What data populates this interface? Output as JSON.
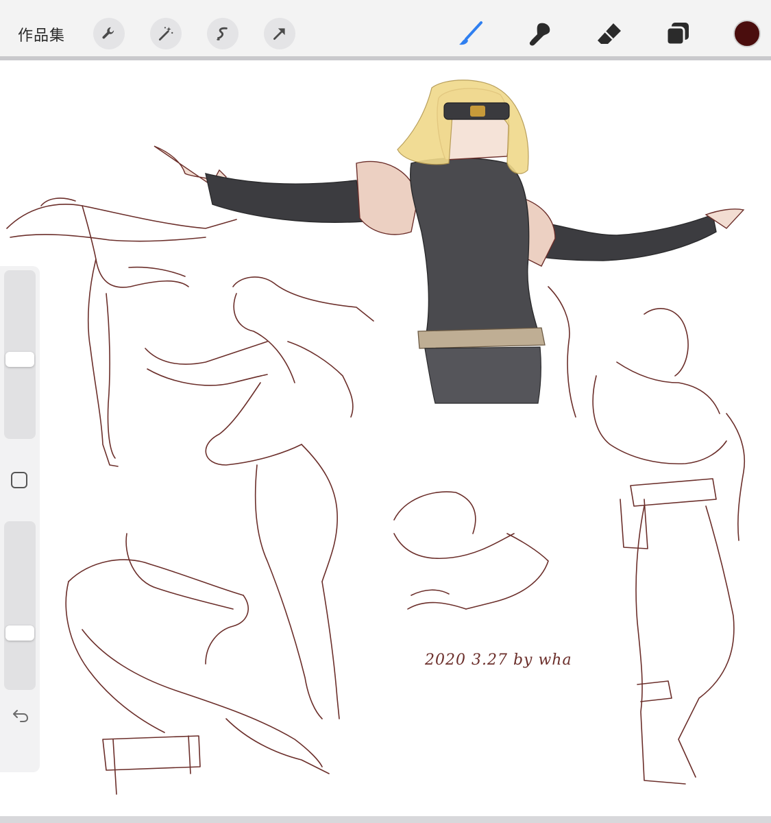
{
  "toolbar": {
    "gallery_label": "作品集",
    "left_tools": [
      "wrench-icon",
      "magic-wand-icon",
      "selection-icon",
      "transform-arrow-icon"
    ],
    "right_tools": [
      "brush-icon",
      "smudge-icon",
      "eraser-icon",
      "layers-icon"
    ],
    "active_tool": "brush-icon",
    "current_color": "#4a0d0d"
  },
  "colors": {
    "accent_blue": "#2f7ff0",
    "sketch_line": "#6b2e2a",
    "toolbar_bg": "#f3f3f3"
  },
  "sidebar": {
    "brush_size_level": 0.47,
    "opacity_level": 0.32,
    "modifier": "square-modifier-icon",
    "undo": "undo-icon"
  },
  "canvas": {
    "signature_text": "2020 3.27 by wha"
  }
}
